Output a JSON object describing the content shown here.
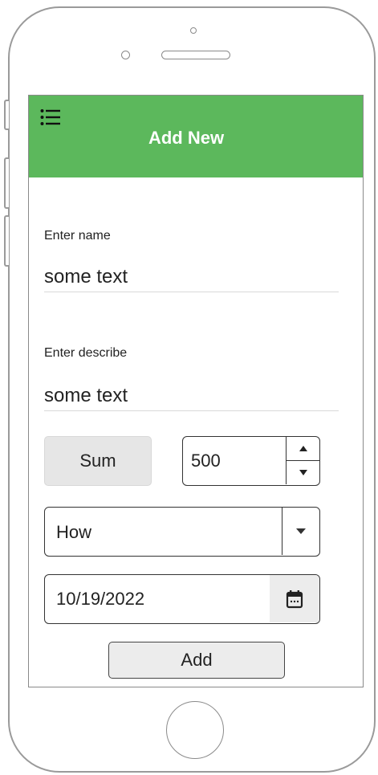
{
  "header": {
    "title": "Add New",
    "menu_icon": "list-menu-icon",
    "color": "#5cb85c"
  },
  "form": {
    "name_label": "Enter name",
    "name_value": "some text",
    "describe_label": "Enter describe",
    "describe_value": "some text",
    "sum_button_label": "Sum",
    "stepper_value": "500",
    "select_value": "How",
    "date_value": "10/19/2022",
    "add_button_label": "Add"
  }
}
